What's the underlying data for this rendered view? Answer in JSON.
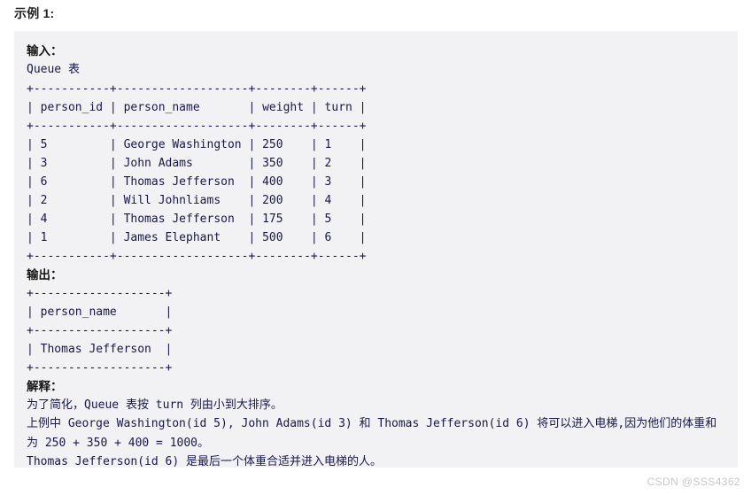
{
  "page": {
    "section_title": "示例 1:",
    "watermark": "CSDN @SSS4362"
  },
  "input": {
    "label": "输入：",
    "table_caption": "Queue 表",
    "ascii_table": "+-----------+-------------------+--------+------+\n| person_id | person_name       | weight | turn |\n+-----------+-------------------+--------+------+\n| 5         | George Washington | 250    | 1    |\n| 3         | John Adams        | 350    | 2    |\n| 6         | Thomas Jefferson  | 400    | 3    |\n| 2         | Will Johnliams    | 200    | 4    |\n| 4         | Thomas Jefferson  | 175    | 5    |\n| 1         | James Elephant    | 500    | 6    |\n+-----------+-------------------+--------+------+"
  },
  "output": {
    "label": "输出：",
    "ascii_table": "+-------------------+\n| person_name       |\n+-------------------+\n| Thomas Jefferson  |\n+-------------------+"
  },
  "explanation": {
    "label": "解释：",
    "line1": "为了简化，Queue 表按 turn 列由小到大排序。",
    "line2": "上例中 George Washington(id 5), John Adams(id 3) 和 Thomas Jefferson(id 6) 将可以进入电梯,因为他们的体重和",
    "line3": "为 250 + 350 + 400 = 1000。",
    "line4": "Thomas Jefferson(id 6) 是最后一个体重合适并进入电梯的人。"
  },
  "table_data": {
    "type": "table",
    "name": "Queue",
    "columns": [
      "person_id",
      "person_name",
      "weight",
      "turn"
    ],
    "rows": [
      [
        5,
        "George Washington",
        250,
        1
      ],
      [
        3,
        "John Adams",
        350,
        2
      ],
      [
        6,
        "Thomas Jefferson",
        400,
        3
      ],
      [
        2,
        "Will Johnliams",
        200,
        4
      ],
      [
        4,
        "Thomas Jefferson",
        175,
        5
      ],
      [
        1,
        "James Elephant",
        500,
        6
      ]
    ],
    "result_columns": [
      "person_name"
    ],
    "result_rows": [
      [
        "Thomas Jefferson"
      ]
    ],
    "weight_sum": 1000,
    "weights_used": [
      250,
      350,
      400
    ]
  }
}
